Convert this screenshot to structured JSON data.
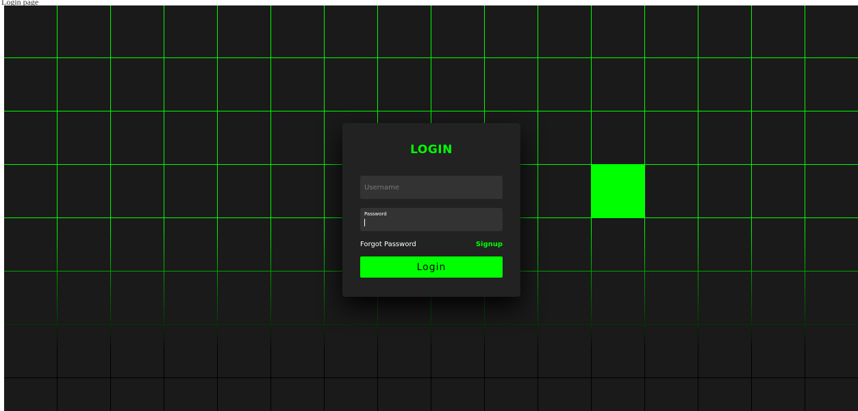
{
  "page": {
    "title": "Login page"
  },
  "grid": {
    "cols": 16,
    "rows": 8,
    "lit_cells": [
      [
        11,
        3
      ]
    ],
    "colors": {
      "cell": "#1a1a1a",
      "lit": "#00ff00",
      "line": "#00ff00",
      "background": "#000000"
    }
  },
  "login": {
    "title": "LOGIN",
    "username_placeholder": "Username",
    "password_label": "Password",
    "password_value": "",
    "forgot_label": "Forgot Password",
    "signup_label": "Signup",
    "button_label": "Login"
  },
  "colors": {
    "accent": "#00ff00",
    "card": "#222222",
    "input": "#333333"
  }
}
